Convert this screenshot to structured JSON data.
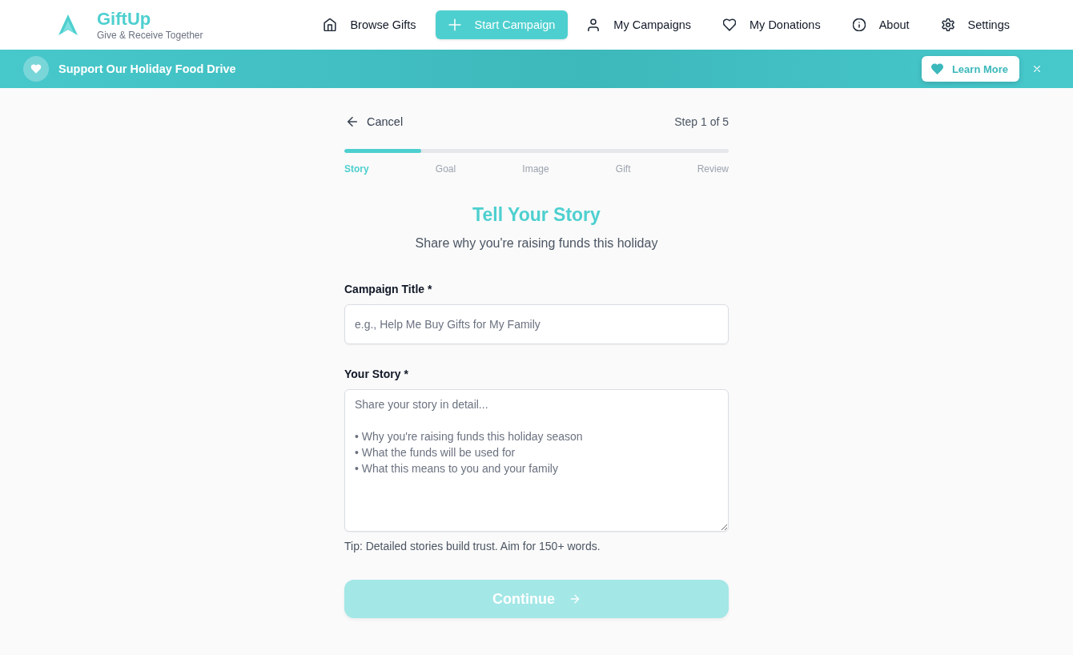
{
  "header": {
    "logo": {
      "title": "GiftUp",
      "tagline": "Give & Receive Together"
    },
    "nav": [
      {
        "label": "Browse Gifts",
        "selected": false
      },
      {
        "label": "Start Campaign",
        "selected": true
      },
      {
        "label": "My Campaigns",
        "selected": false
      },
      {
        "label": "My Donations",
        "selected": false
      },
      {
        "label": "About",
        "selected": false
      },
      {
        "label": "Settings",
        "selected": false
      }
    ]
  },
  "banner": {
    "title": "Support Our Holiday Food Drive",
    "button": "Learn More"
  },
  "wizard": {
    "cancel": "Cancel",
    "step_count": "Step 1 of 5",
    "progress": {
      "level": 0.2
    },
    "steps": [
      {
        "label": "Story",
        "active": true
      },
      {
        "label": "Goal",
        "active": false
      },
      {
        "label": "Image",
        "active": false
      },
      {
        "label": "Gift",
        "active": false
      },
      {
        "label": "Review",
        "active": false
      }
    ],
    "heading": "Tell Your Story",
    "subheading": "Share why you're raising funds this holiday",
    "fields": [
      {
        "kind": "input",
        "label": "Campaign Title *",
        "placeholder": "e.g., Help Me Buy Gifts for My Family"
      },
      {
        "kind": "textarea",
        "label": "Your Story *",
        "placeholder": "Share your story in detail...\n\n• Why you're raising funds this holiday season\n• What the funds will be used for\n• What this means to you and your family",
        "hint": "Tip: Detailed stories build trust. Aim for 150+ words."
      }
    ],
    "continue": {
      "label": "Continue",
      "disabled": true
    }
  }
}
